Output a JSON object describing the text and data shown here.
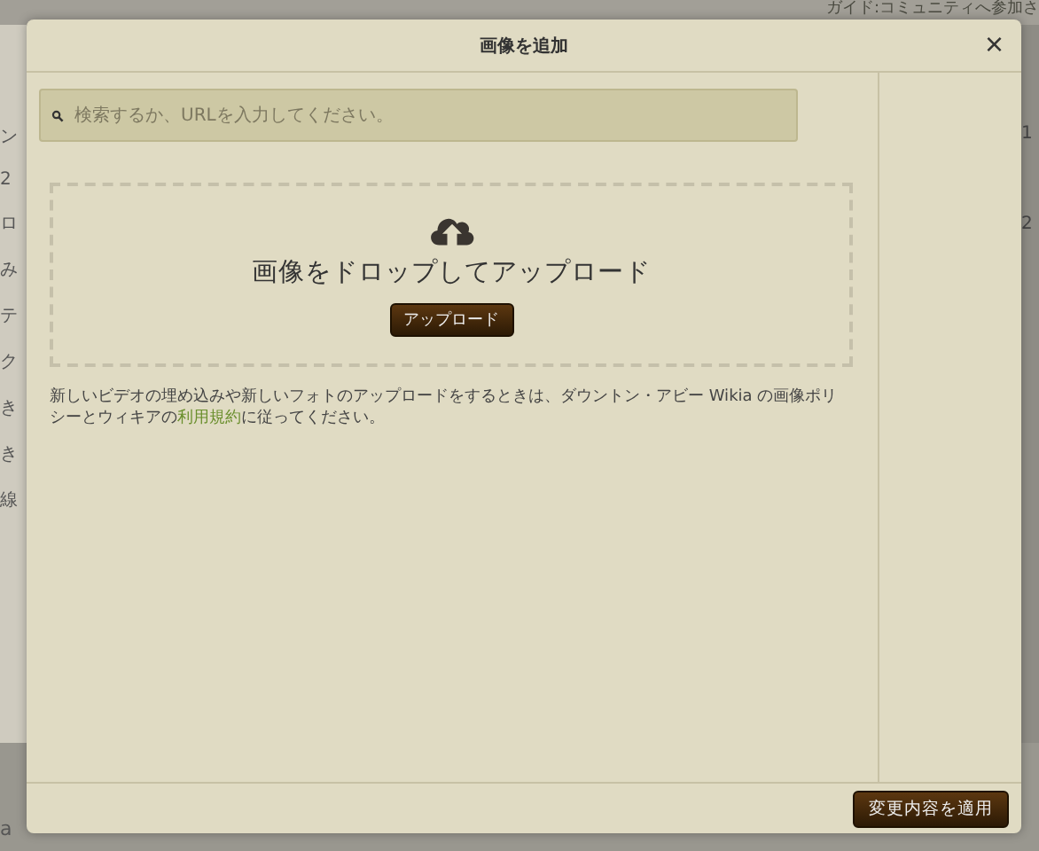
{
  "backdrop": {
    "guide_link": "ガイド:コミュニティへ参加さ",
    "left_fragments": [
      "ン",
      "2",
      "ロ",
      "み",
      "テ",
      "ク",
      "き",
      "き",
      "線"
    ],
    "right_fragments": [
      "1",
      "2"
    ],
    "bottom_fragment": "a"
  },
  "dialog": {
    "title": "画像を追加",
    "close": "×",
    "search": {
      "placeholder": "検索するか、URLを入力してください。"
    },
    "dropzone": {
      "heading": "画像をドロップしてアップロード",
      "button": "アップロード"
    },
    "notice": {
      "text": "新しいビデオの埋め込みや新しいフォトのアップロードをするときは、ダウントン・アビー Wikia の画像ポリシーとウィキアの",
      "link": "利用規約",
      "after": "に従ってください。"
    },
    "apply_button": "変更内容を適用"
  }
}
